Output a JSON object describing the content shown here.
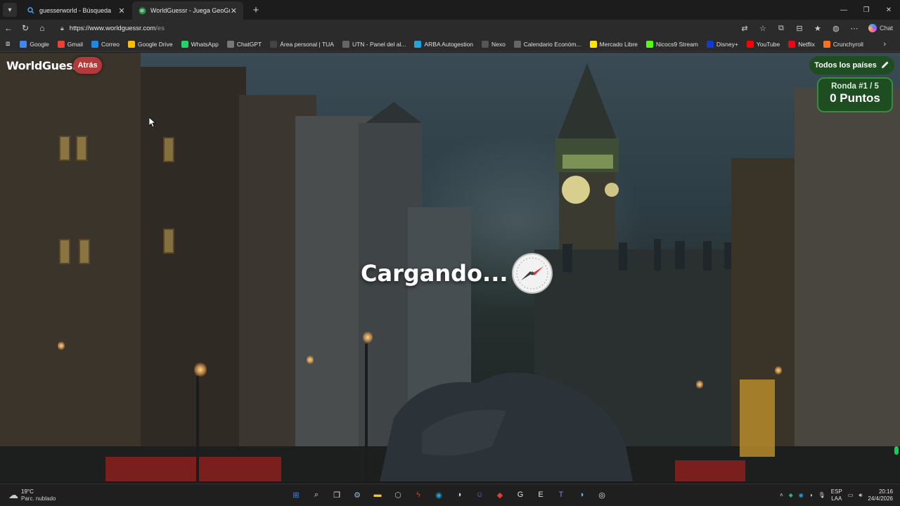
{
  "browser": {
    "tabs": [
      {
        "title": "guesserworld - Búsqueda",
        "favicon": "search-icon",
        "active": false
      },
      {
        "title": "WorldGuessr - Juega GeoGuessr g",
        "favicon": "globe-icon",
        "active": true
      }
    ],
    "url_host": "https://www.worldguessr.com",
    "url_path": "/es",
    "chat_label": "Chat",
    "bookmarks": [
      {
        "label": "Google",
        "icon": "google-icon",
        "color": "#4285f4"
      },
      {
        "label": "Gmail",
        "icon": "gmail-icon",
        "color": "#ea4335"
      },
      {
        "label": "Correo",
        "icon": "mail-icon",
        "color": "#1e88e5"
      },
      {
        "label": "Google Drive",
        "icon": "drive-icon",
        "color": "#fbbc04"
      },
      {
        "label": "WhatsApp",
        "icon": "whatsapp-icon",
        "color": "#25d366"
      },
      {
        "label": "ChatGPT",
        "icon": "chatgpt-icon",
        "color": "#777777"
      },
      {
        "label": "Área personal | TUA",
        "icon": "tua-icon",
        "color": "#444444"
      },
      {
        "label": "UTN - Panel del al...",
        "icon": "globe-icon",
        "color": "#666666"
      },
      {
        "label": "ARBA Autogestion",
        "icon": "arba-icon",
        "color": "#26a3d9"
      },
      {
        "label": "Nexo",
        "icon": "nexo-icon",
        "color": "#555555"
      },
      {
        "label": "Calendario Económ...",
        "icon": "calendar-icon",
        "color": "#666666"
      },
      {
        "label": "Mercado Libre",
        "icon": "mercadolibre-icon",
        "color": "#ffe600"
      },
      {
        "label": "Nicocs9 Stream",
        "icon": "kick-icon",
        "color": "#53fc18"
      },
      {
        "label": "Disney+",
        "icon": "disney-icon",
        "color": "#113ccf"
      },
      {
        "label": "YouTube",
        "icon": "youtube-icon",
        "color": "#ff0000"
      },
      {
        "label": "Netflix",
        "icon": "netflix-icon",
        "color": "#e50914"
      },
      {
        "label": "Crunchyroll",
        "icon": "crunchyroll-icon",
        "color": "#f47521"
      }
    ]
  },
  "game": {
    "logo": "WorldGuessr",
    "back_label": "Atrás",
    "countries_label": "Todos los países",
    "round_label": "Ronda #1 / 5",
    "points_label": "0 Puntos",
    "loading_text": "Cargando..."
  },
  "taskbar": {
    "temperature": "19°C",
    "weather_desc": "Parc. nublado",
    "lang_1": "ESP",
    "lang_2": "LAA",
    "time": "20:16",
    "date": "24/4/2026",
    "apps": [
      {
        "name": "windows-start-icon",
        "glyph": "⊞",
        "color": "#2b8cff"
      },
      {
        "name": "search-icon",
        "glyph": "⌕",
        "color": "#e0e0e0"
      },
      {
        "name": "task-view-icon",
        "glyph": "❐",
        "color": "#e0e0e0"
      },
      {
        "name": "settings-icon",
        "glyph": "⚙",
        "color": "#9fb6d9"
      },
      {
        "name": "file-explorer-icon",
        "glyph": "▬",
        "color": "#f5c242"
      },
      {
        "name": "app-icon",
        "glyph": "⬡",
        "color": "#bdbdbd"
      },
      {
        "name": "flash-app-icon",
        "glyph": "ϟ",
        "color": "#e53935"
      },
      {
        "name": "edge-icon",
        "glyph": "◉",
        "color": "#1ba1e2"
      },
      {
        "name": "steam-icon",
        "glyph": "◑",
        "color": "#c9d6e3"
      },
      {
        "name": "discord-icon",
        "glyph": "☺",
        "color": "#5865f2"
      },
      {
        "name": "red-app-icon",
        "glyph": "◆",
        "color": "#e53935"
      },
      {
        "name": "g-app-icon",
        "glyph": "G",
        "color": "#e0e0e0"
      },
      {
        "name": "epic-games-icon",
        "glyph": "E",
        "color": "#e0e0e0"
      },
      {
        "name": "teams-icon",
        "glyph": "T",
        "color": "#7b83eb"
      },
      {
        "name": "steam-alt-icon",
        "glyph": "◑",
        "color": "#66c0f4"
      },
      {
        "name": "chrome-icon",
        "glyph": "◎",
        "color": "#e0e0e0"
      }
    ]
  }
}
